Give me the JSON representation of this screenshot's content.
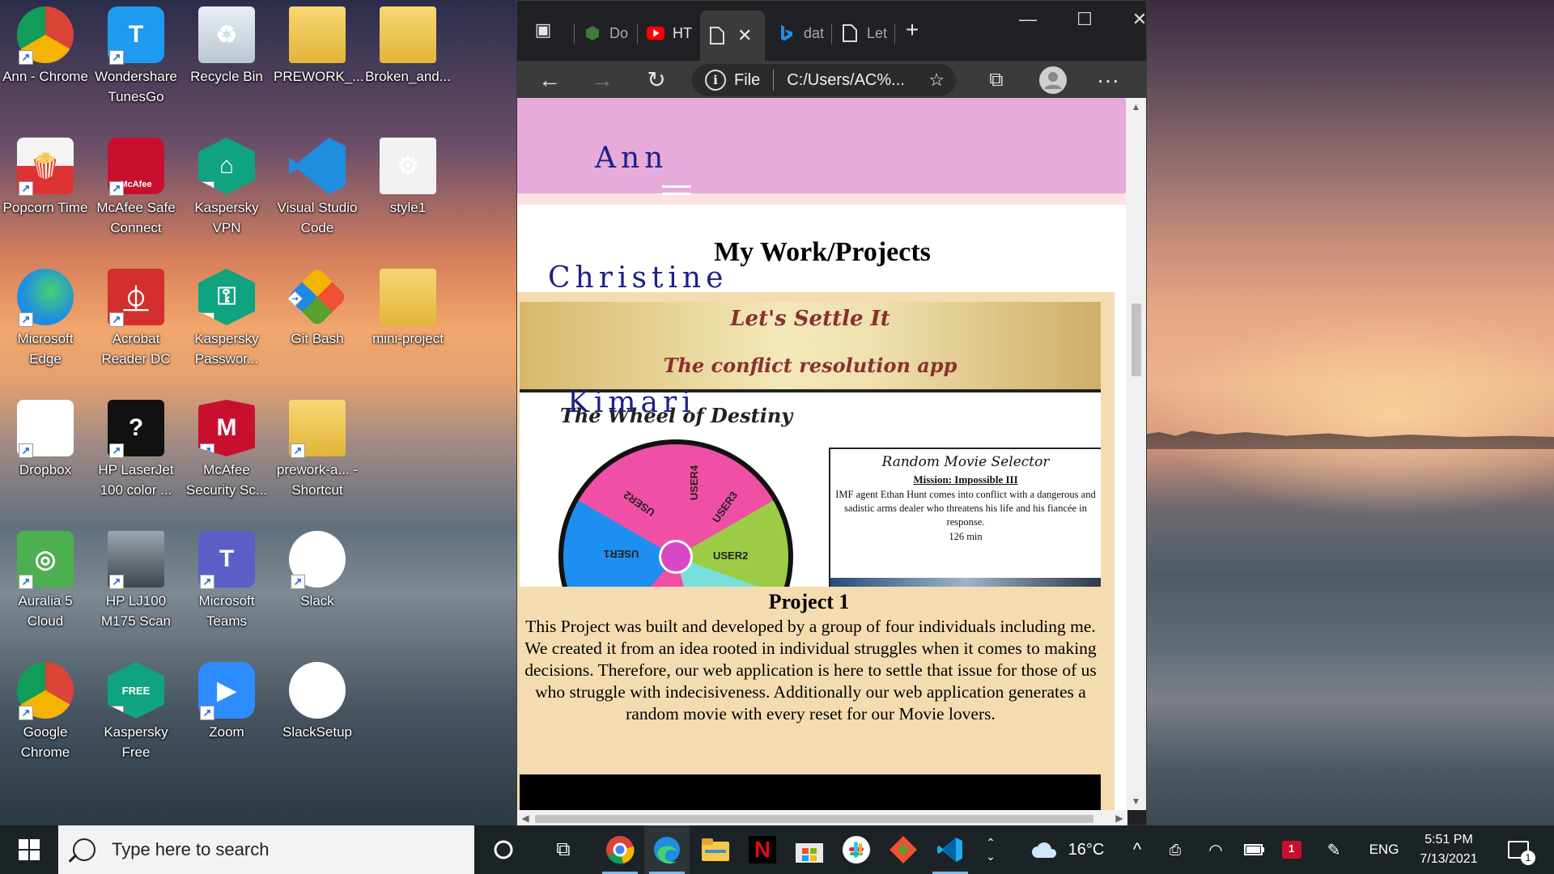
{
  "desktop": {
    "icons": [
      {
        "label": "Ann - Chrome"
      },
      {
        "label": "Wondershare TunesGo"
      },
      {
        "label": "Recycle Bin"
      },
      {
        "label": "PREWORK_..."
      },
      {
        "label": "Broken_and..."
      },
      {
        "label": "Popcorn Time"
      },
      {
        "label": "McAfee Safe Connect"
      },
      {
        "label": "Kaspersky VPN"
      },
      {
        "label": "Visual Studio Code"
      },
      {
        "label": "style1"
      },
      {
        "label": "Microsoft Edge"
      },
      {
        "label": "Acrobat Reader DC"
      },
      {
        "label": "Kaspersky Passwor..."
      },
      {
        "label": "Git Bash"
      },
      {
        "label": "mini-project"
      },
      {
        "label": "Dropbox"
      },
      {
        "label": "HP LaserJet 100 color ..."
      },
      {
        "label": "McAfee Security Sc..."
      },
      {
        "label": "prework-a... - Shortcut"
      },
      {
        "label": "Auralia 5 Cloud"
      },
      {
        "label": "HP LJ100 M175 Scan"
      },
      {
        "label": "Microsoft Teams"
      },
      {
        "label": "Slack"
      },
      {
        "label": "Google Chrome"
      },
      {
        "label": "Kaspersky Free"
      },
      {
        "label": "Zoom"
      },
      {
        "label": "SlackSetup"
      }
    ],
    "mcafee_badge": "McAfee",
    "kaspersky_free_badge": "FREE"
  },
  "browser": {
    "tabs": [
      {
        "label": "Do"
      },
      {
        "label": "HT"
      },
      {
        "label": ""
      },
      {
        "label": "dat"
      },
      {
        "label": "Let"
      }
    ],
    "address": {
      "scheme": "File",
      "url": "C:/Users/AC%..."
    },
    "page": {
      "name_words": [
        "Ann",
        "Christine",
        "Kimari"
      ],
      "section_title": "My Work/Projects",
      "project": {
        "banner_title": "Let's Settle It",
        "banner_subtitle": "The conflict resolution app",
        "wheel_title": "The Wheel of Destiny",
        "wheel_labels": [
          "USER4",
          "USER3",
          "USER2",
          "USER1",
          "USER2"
        ],
        "movie": {
          "title": "Random Movie Selector",
          "mission": "Mission: Impossible III",
          "description": "IMF agent Ethan Hunt comes into conflict with a dangerous and sadistic arms dealer who threatens his life and his fiancée in response.",
          "runtime": "126 min"
        },
        "title": "Project 1",
        "description": "This Project was built and developed by a group of four individuals including me. We created it from an idea rooted in individual struggles when it comes to making decisions. Therefore, our web application is here to settle that issue for those of us who struggle with indecisiveness. Additionally our web application generates a random movie with every reset for our Movie lovers."
      }
    },
    "colors": {
      "header_bg": "#e6aadb",
      "card_bg": "#f5dcb0",
      "name_color": "#1f1f8a"
    }
  },
  "taskbar": {
    "search_placeholder": "Type here to search",
    "weather": "16°C",
    "language": "ENG",
    "time": "5:51 PM",
    "date": "7/13/2021",
    "notification_count": "1",
    "mcafee_tray_badge": "1"
  }
}
